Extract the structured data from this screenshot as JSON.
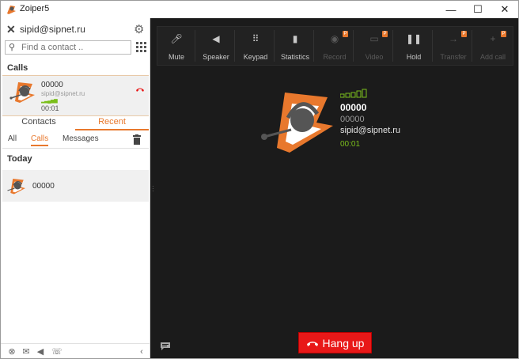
{
  "window": {
    "title": "Zoiper5",
    "minimize": "—",
    "maximize": "☐",
    "close": "✕"
  },
  "account": {
    "name": "sipid@sipnet.ru"
  },
  "search": {
    "placeholder": "Find a contact .."
  },
  "calls": {
    "section_title": "Calls",
    "active": {
      "number": "00000",
      "account": "sipid@sipnet.ru",
      "signal": "▂▃▄▅▆",
      "duration": "00:01"
    }
  },
  "tabs": {
    "contacts": "Contacts",
    "recent": "Recent"
  },
  "subtabs": {
    "all": "All",
    "calls": "Calls",
    "messages": "Messages"
  },
  "recent": {
    "section_title": "Today",
    "items": [
      {
        "number": "00000"
      }
    ]
  },
  "toolbar": [
    {
      "label": "Mute",
      "icon": "microphone-icon",
      "glyph": "🎤︎",
      "enabled": true,
      "locked": false
    },
    {
      "label": "Speaker",
      "icon": "speaker-icon",
      "glyph": "◀",
      "enabled": true,
      "locked": false
    },
    {
      "label": "Keypad",
      "icon": "keypad-icon",
      "glyph": "⠿",
      "enabled": true,
      "locked": false
    },
    {
      "label": "Statistics",
      "icon": "statistics-icon",
      "glyph": "▮",
      "enabled": true,
      "locked": false
    },
    {
      "label": "Record",
      "icon": "record-icon",
      "glyph": "◉",
      "enabled": false,
      "locked": true
    },
    {
      "label": "Video",
      "icon": "video-icon",
      "glyph": "▭",
      "enabled": false,
      "locked": true
    },
    {
      "label": "Hold",
      "icon": "pause-icon",
      "glyph": "❚❚",
      "enabled": true,
      "locked": false
    },
    {
      "label": "Transfer",
      "icon": "transfer-icon",
      "glyph": "→",
      "enabled": false,
      "locked": true
    },
    {
      "label": "Add call",
      "icon": "add-call-icon",
      "glyph": "+",
      "enabled": false,
      "locked": true
    }
  ],
  "call_panel": {
    "number": "00000",
    "number2": "00000",
    "account": "sipid@sipnet.ru",
    "duration": "00:01"
  },
  "hangup": {
    "label": "Hang up"
  },
  "colors": {
    "accent": "#e8782d",
    "signal": "#7bbf1c",
    "hangup": "#e81818",
    "dark_bg": "#1b1b1b"
  }
}
